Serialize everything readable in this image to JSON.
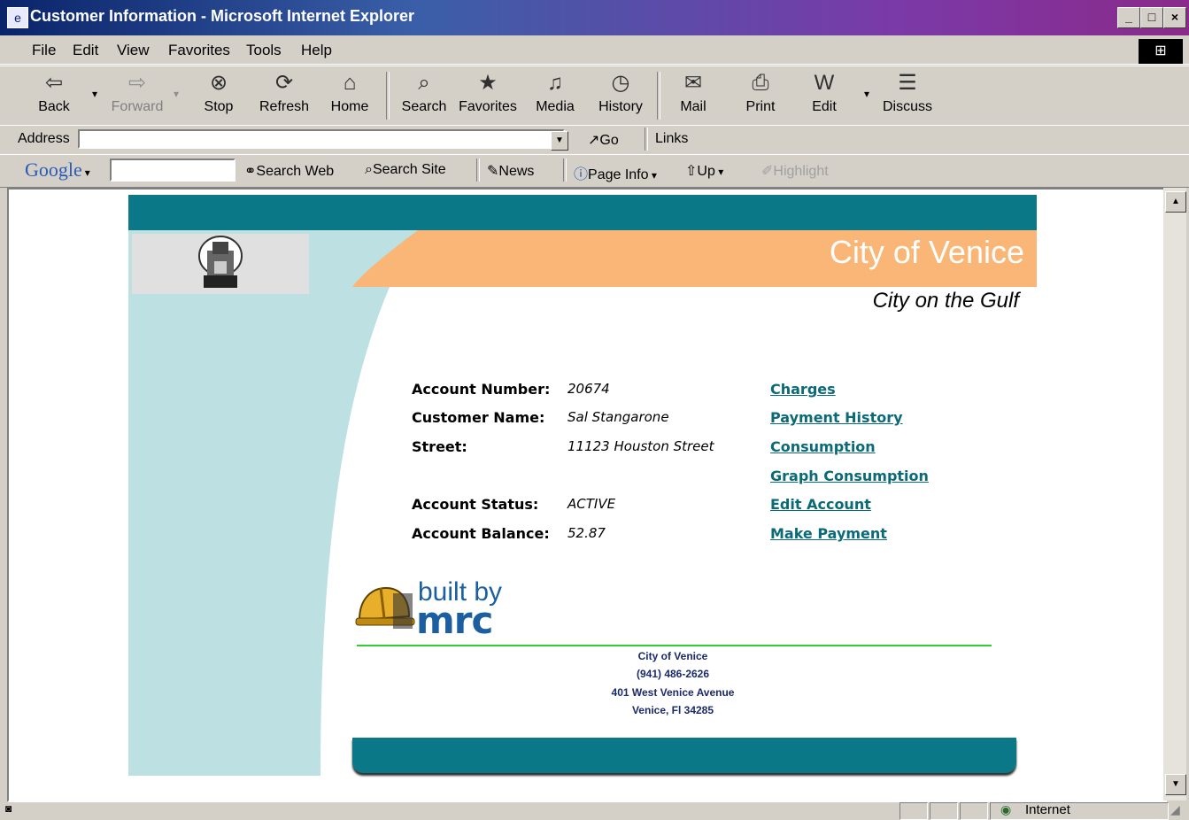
{
  "window": {
    "title": "Customer Information - Microsoft Internet Explorer"
  },
  "menu": {
    "items": [
      "File",
      "Edit",
      "View",
      "Favorites",
      "Tools",
      "Help"
    ]
  },
  "toolbar": {
    "buttons": [
      "Back",
      "Forward",
      "Stop",
      "Refresh",
      "Home",
      "Search",
      "Favorites",
      "Media",
      "History",
      "Mail",
      "Print",
      "Edit",
      "Discuss"
    ]
  },
  "address": {
    "label": "Address",
    "value": "",
    "go_label": "Go",
    "links_label": "Links"
  },
  "google_bar": {
    "logo": "Google",
    "search_web": "Search Web",
    "search_site": "Search Site",
    "news": "News",
    "page_info": "Page Info",
    "up": "Up",
    "highlight": "Highlight"
  },
  "page": {
    "city_name": "City of Venice",
    "tagline": "City on the Gulf",
    "account_fields": [
      {
        "label": "Account Number:",
        "value": "20674"
      },
      {
        "label": "Customer Name:",
        "value": "Sal Stangarone"
      },
      {
        "label": "Street:",
        "value": "11123 Houston Street"
      },
      {
        "label": "Account Status:",
        "value": "ACTIVE"
      },
      {
        "label": "Account Balance:",
        "value": "52.87"
      }
    ],
    "links": [
      "Charges",
      "Payment History",
      "Consumption",
      "Graph Consumption",
      "Edit Account",
      "Make Payment"
    ],
    "built_by_text": "built by",
    "built_by_brand": "mrc",
    "footer": {
      "line1": "City of Venice",
      "line2": "(941) 486-2626",
      "line3": "401 West Venice Avenue",
      "line4": "Venice, Fl 34285"
    }
  },
  "status": {
    "zone": "Internet"
  },
  "colors": {
    "teal": "#0a7886",
    "light_blue": "#bde0e3",
    "orange": "#f9b676",
    "link": "#0a6a78",
    "green_rule": "#33cc33"
  }
}
